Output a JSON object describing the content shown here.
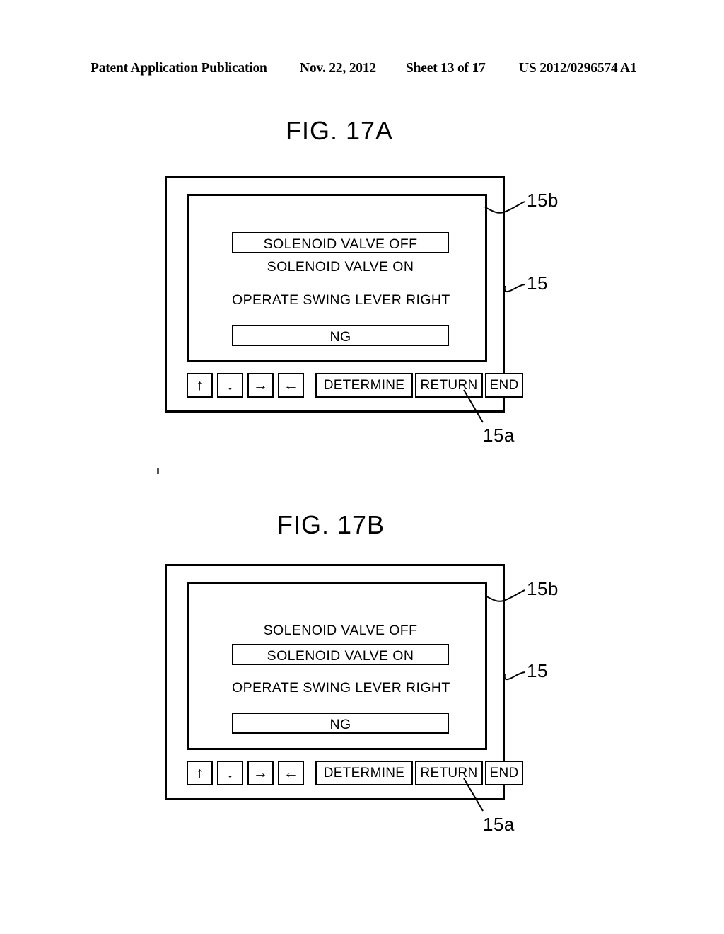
{
  "header": {
    "publication": "Patent Application Publication",
    "date": "Nov. 22, 2012",
    "sheet": "Sheet 13 of 17",
    "number": "US 2012/0296574 A1"
  },
  "figures": [
    {
      "title": "FIG. 17A",
      "screen_lines": [
        {
          "text": "SOLENOID VALVE OFF",
          "boxed": true
        },
        {
          "text": "SOLENOID VALVE ON",
          "boxed": false
        },
        {
          "text": "OPERATE SWING LEVER RIGHT",
          "boxed": false
        },
        {
          "text": "NG",
          "boxed": true
        }
      ],
      "buttons": [
        {
          "label": "↑",
          "kind": "arrow"
        },
        {
          "label": "↓",
          "kind": "arrow"
        },
        {
          "label": "→",
          "kind": "arrow"
        },
        {
          "label": "←",
          "kind": "arrow"
        },
        {
          "label": "DETERMINE",
          "kind": "wide"
        },
        {
          "label": "RETURN",
          "kind": "med"
        },
        {
          "label": "END",
          "kind": "small"
        }
      ],
      "refs": {
        "display": "15b",
        "device": "15",
        "keypad": "15a"
      }
    },
    {
      "title": "FIG. 17B",
      "screen_lines": [
        {
          "text": "SOLENOID VALVE OFF",
          "boxed": false
        },
        {
          "text": "SOLENOID VALVE ON",
          "boxed": true
        },
        {
          "text": "OPERATE SWING LEVER RIGHT",
          "boxed": false
        },
        {
          "text": "NG",
          "boxed": true
        }
      ],
      "buttons": [
        {
          "label": "↑",
          "kind": "arrow"
        },
        {
          "label": "↓",
          "kind": "arrow"
        },
        {
          "label": "→",
          "kind": "arrow"
        },
        {
          "label": "←",
          "kind": "arrow"
        },
        {
          "label": "DETERMINE",
          "kind": "wide"
        },
        {
          "label": "RETURN",
          "kind": "med"
        },
        {
          "label": "END",
          "kind": "small"
        }
      ],
      "refs": {
        "display": "15b",
        "device": "15",
        "keypad": "15a"
      }
    }
  ],
  "colors": {
    "ink": "#000000",
    "paper": "#ffffff"
  }
}
